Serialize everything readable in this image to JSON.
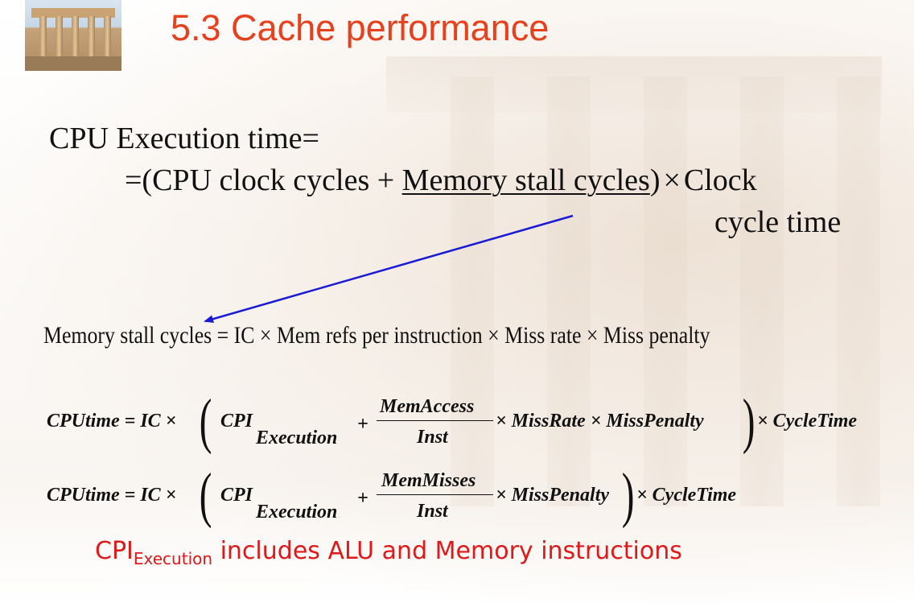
{
  "title": "5.3  Cache performance",
  "cpu_exec": {
    "line1": "CPU Execution time=",
    "line2_prefix": "=(CPU clock cycles + ",
    "line2_underlined": "Memory stall cycles",
    "line2_suffix": ")",
    "times_symbol": "×",
    "line2_end": "Clock",
    "line3": "cycle time"
  },
  "stall_formula": "Memory stall cycles  =  IC × Mem refs per instruction × Miss rate × Miss penalty",
  "formula2": {
    "lhs": "CPUtime = IC ×",
    "cpi": "CPI",
    "cpi_sub": "Execution",
    "plus": "+",
    "numerator": "MemAccess",
    "denominator": "Inst",
    "rest": "× MissRate × MissPenalty",
    "tail": "× CycleTime"
  },
  "formula3": {
    "lhs": "CPUtime = IC ×",
    "cpi": "CPI",
    "cpi_sub": "Execution",
    "plus": "+",
    "numerator": "MemMisses",
    "denominator": "Inst",
    "rest": "× MissPenalty",
    "tail": "× CycleTime"
  },
  "note": {
    "cpi": "CPI",
    "sub": "Execution",
    "text": " includes ALU and Memory instructions"
  },
  "colors": {
    "title": "#e8401c",
    "note": "#e01818",
    "arrow": "#1a1ad6"
  },
  "icons": {
    "thumbnail": "parthenon-thumbnail-icon"
  }
}
